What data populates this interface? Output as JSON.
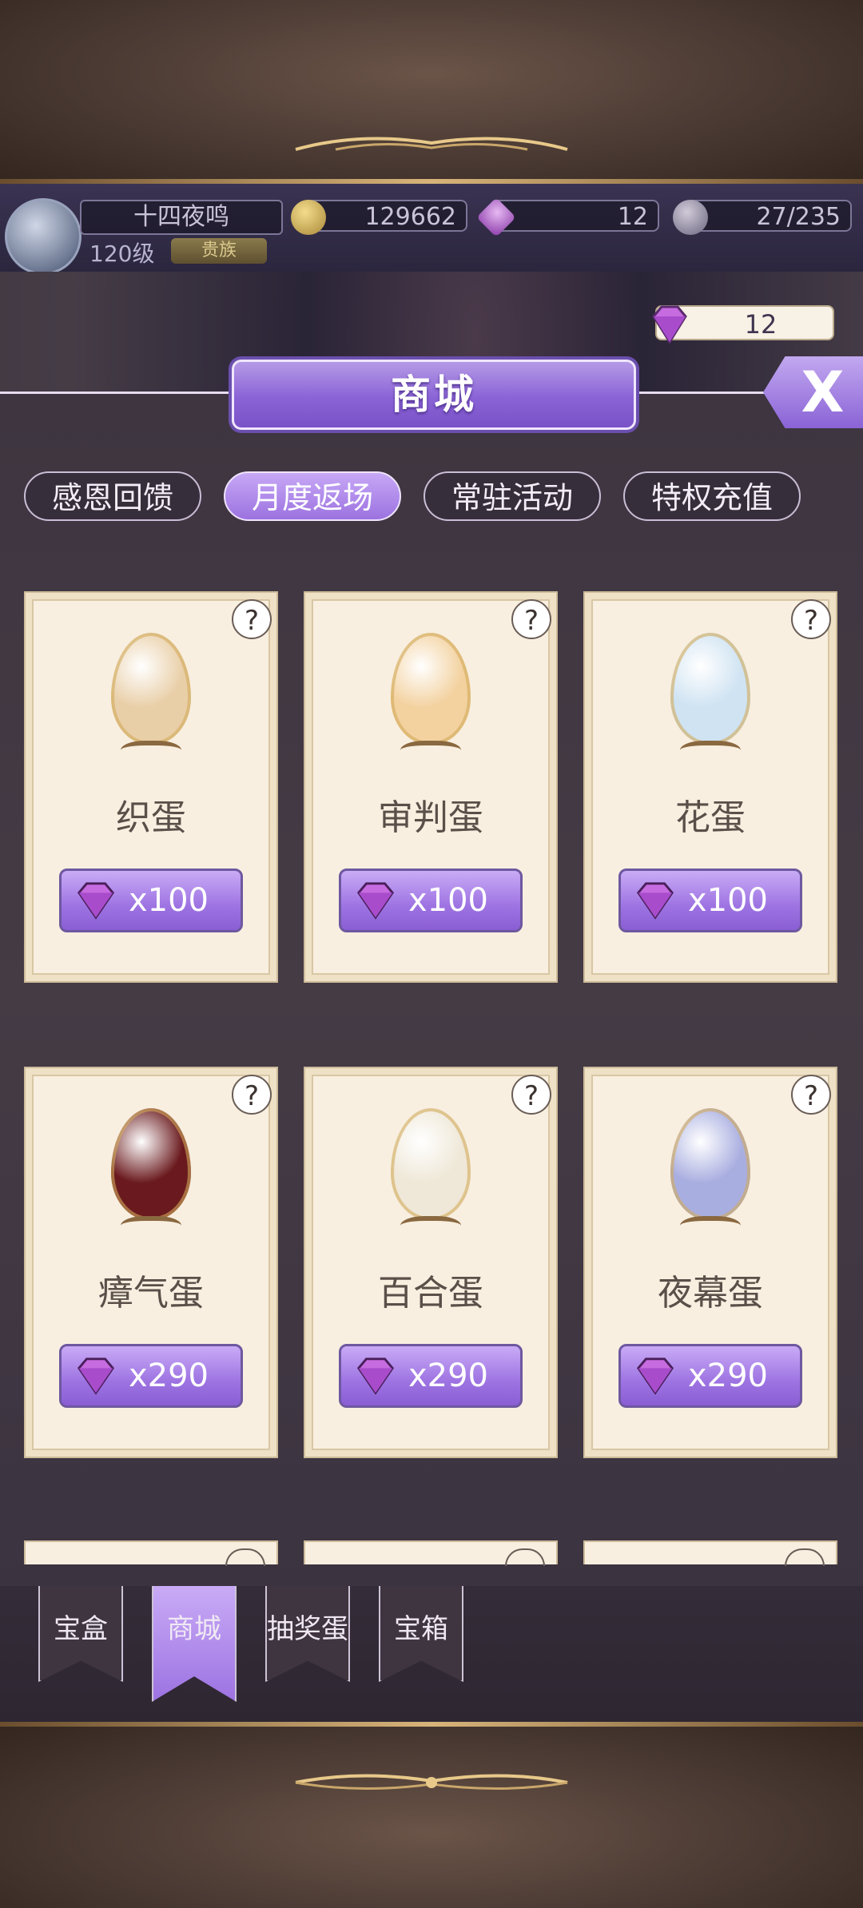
{
  "player": {
    "name": "十四夜鸣",
    "level": "120级",
    "badge": "贵族"
  },
  "resources": {
    "gold": "129662",
    "gems": "12",
    "stamina": "27/235"
  },
  "gem_balance": "12",
  "shop": {
    "title": "商城",
    "close_label": "X"
  },
  "tabs": [
    {
      "label": "感恩回馈",
      "active": false
    },
    {
      "label": "月度返场",
      "active": true
    },
    {
      "label": "常驻活动",
      "active": false
    },
    {
      "label": "特权充值",
      "active": false
    }
  ],
  "items": [
    {
      "name": "织蛋",
      "price": "x100",
      "help": "?",
      "egg_color": "#e9cfa8"
    },
    {
      "name": "审判蛋",
      "price": "x100",
      "help": "?",
      "egg_color": "#f3d2a0"
    },
    {
      "name": "花蛋",
      "price": "x100",
      "help": "?",
      "egg_color": "#cfe3f2"
    },
    {
      "name": "瘴气蛋",
      "price": "x290",
      "help": "?",
      "egg_color": "#6a1a1e"
    },
    {
      "name": "百合蛋",
      "price": "x290",
      "help": "?",
      "egg_color": "#efe8d8"
    },
    {
      "name": "夜幕蛋",
      "price": "x290",
      "help": "?",
      "egg_color": "#a9aee0"
    }
  ],
  "bottom_nav": [
    {
      "label": "宝盒",
      "active": false
    },
    {
      "label": "商城",
      "active": true
    },
    {
      "label": "抽奖蛋",
      "active": false
    },
    {
      "label": "宝箱",
      "active": false
    }
  ],
  "colors": {
    "accent": "#9d73e2",
    "card_bg": "#f8efe0"
  }
}
